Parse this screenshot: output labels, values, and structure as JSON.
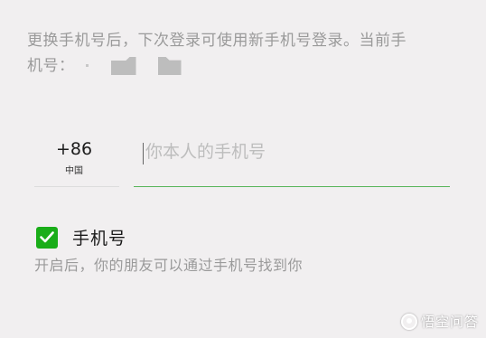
{
  "description": {
    "line1": "更换手机号后，下次登录可使用新手机号登录。当前手",
    "line2": "机号："
  },
  "country": {
    "code": "+86",
    "name": "中国"
  },
  "phone_input": {
    "value": "",
    "placeholder": "你本人的手机号"
  },
  "toggle": {
    "label": "手机号",
    "checked": true,
    "description": "开启后，你的朋友可以通过手机号找到你"
  },
  "watermark": {
    "text": "悟空问答"
  },
  "colors": {
    "accent_green": "#1aad19",
    "input_underline": "#57b45a",
    "background": "#f1eff0",
    "secondary_text": "#9a9a9a"
  }
}
